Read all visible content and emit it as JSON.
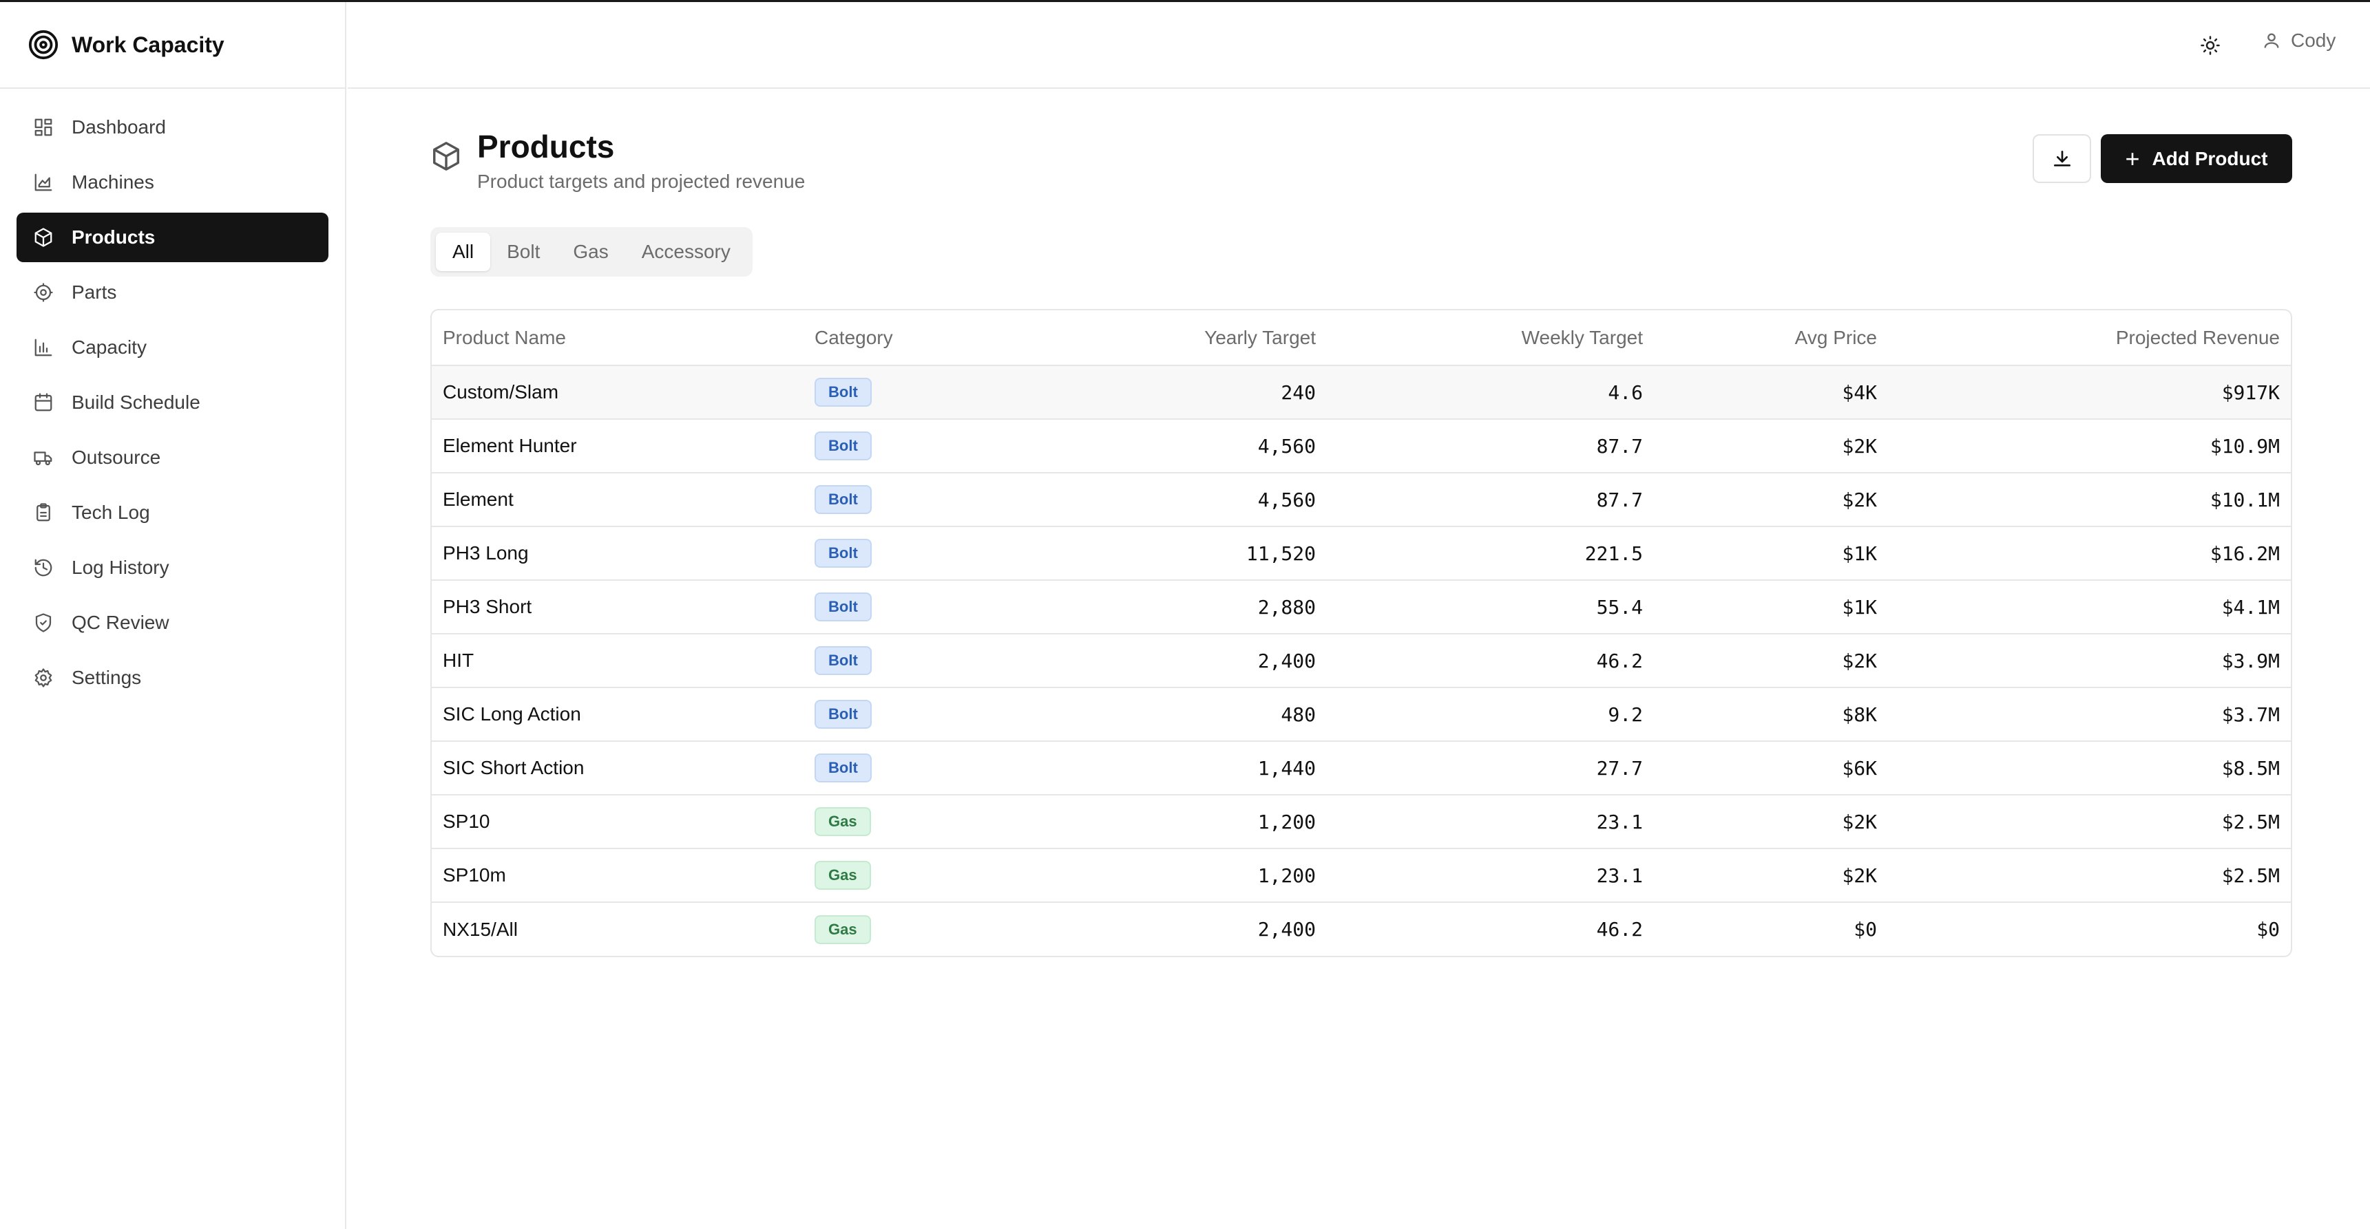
{
  "app": {
    "title": "Work Capacity"
  },
  "sidebar": {
    "items": [
      {
        "label": "Dashboard",
        "icon": "dashboard-icon"
      },
      {
        "label": "Machines",
        "icon": "chart-area-icon"
      },
      {
        "label": "Products",
        "icon": "package-icon",
        "active": true
      },
      {
        "label": "Parts",
        "icon": "cog-icon"
      },
      {
        "label": "Capacity",
        "icon": "bar-chart-icon"
      },
      {
        "label": "Build Schedule",
        "icon": "calendar-icon"
      },
      {
        "label": "Outsource",
        "icon": "truck-icon"
      },
      {
        "label": "Tech Log",
        "icon": "clipboard-icon"
      },
      {
        "label": "Log History",
        "icon": "history-icon"
      },
      {
        "label": "QC Review",
        "icon": "shield-check-icon"
      },
      {
        "label": "Settings",
        "icon": "settings-icon"
      }
    ]
  },
  "topbar": {
    "user_name": "Cody",
    "theme_icon": "sun-icon",
    "user_icon": "user-icon"
  },
  "page": {
    "title": "Products",
    "subtitle": "Product targets and projected revenue",
    "add_button": "Add Product",
    "download_icon": "download-icon"
  },
  "filters": {
    "tabs": [
      "All",
      "Bolt",
      "Gas",
      "Accessory"
    ],
    "selected": "All"
  },
  "table": {
    "headers": [
      "Product Name",
      "Category",
      "Yearly Target",
      "Weekly Target",
      "Avg Price",
      "Projected Revenue"
    ],
    "rows": [
      {
        "name": "Custom/Slam",
        "category": "Bolt",
        "yearly": "240",
        "weekly": "4.6",
        "price": "$4K",
        "revenue": "$917K"
      },
      {
        "name": "Element Hunter",
        "category": "Bolt",
        "yearly": "4,560",
        "weekly": "87.7",
        "price": "$2K",
        "revenue": "$10.9M"
      },
      {
        "name": "Element",
        "category": "Bolt",
        "yearly": "4,560",
        "weekly": "87.7",
        "price": "$2K",
        "revenue": "$10.1M"
      },
      {
        "name": "PH3 Long",
        "category": "Bolt",
        "yearly": "11,520",
        "weekly": "221.5",
        "price": "$1K",
        "revenue": "$16.2M"
      },
      {
        "name": "PH3 Short",
        "category": "Bolt",
        "yearly": "2,880",
        "weekly": "55.4",
        "price": "$1K",
        "revenue": "$4.1M"
      },
      {
        "name": "HIT",
        "category": "Bolt",
        "yearly": "2,400",
        "weekly": "46.2",
        "price": "$2K",
        "revenue": "$3.9M"
      },
      {
        "name": "SIC Long Action",
        "category": "Bolt",
        "yearly": "480",
        "weekly": "9.2",
        "price": "$8K",
        "revenue": "$3.7M"
      },
      {
        "name": "SIC Short Action",
        "category": "Bolt",
        "yearly": "1,440",
        "weekly": "27.7",
        "price": "$6K",
        "revenue": "$8.5M"
      },
      {
        "name": "SP10",
        "category": "Gas",
        "yearly": "1,200",
        "weekly": "23.1",
        "price": "$2K",
        "revenue": "$2.5M"
      },
      {
        "name": "SP10m",
        "category": "Gas",
        "yearly": "1,200",
        "weekly": "23.1",
        "price": "$2K",
        "revenue": "$2.5M"
      },
      {
        "name": "NX15/All",
        "category": "Gas",
        "yearly": "2,400",
        "weekly": "46.2",
        "price": "$0",
        "revenue": "$0"
      }
    ]
  },
  "colors": {
    "accent": "#141414",
    "bolt_badge": "#dbe8fb",
    "gas_badge": "#dcf5e4"
  }
}
